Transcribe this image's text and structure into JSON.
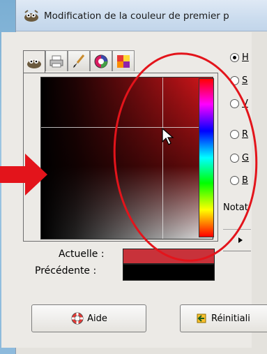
{
  "window": {
    "title": "Modification de la couleur de premier p"
  },
  "tabs": [
    {
      "name": "gimp-selector",
      "icon": "gimp-wilber-icon"
    },
    {
      "name": "printer-selector",
      "icon": "printer-icon"
    },
    {
      "name": "brush-selector",
      "icon": "paintbrush-icon"
    },
    {
      "name": "wheel-selector",
      "icon": "color-wheel-icon"
    },
    {
      "name": "palette-selector",
      "icon": "palette-icon"
    }
  ],
  "channels": [
    {
      "label": "H",
      "selected": true
    },
    {
      "label": "S",
      "selected": false
    },
    {
      "label": "V",
      "selected": false
    },
    {
      "label": "R",
      "selected": false
    },
    {
      "label": "G",
      "selected": false
    },
    {
      "label": "B",
      "selected": false
    }
  ],
  "notation_label": "Notat",
  "current_label": "Actuelle :",
  "previous_label": "Précédente :",
  "current_color": "#c8323a",
  "previous_color": "#000000",
  "buttons": {
    "help": "Aide",
    "reset": "Réinitiali"
  },
  "colors": {
    "annotation_red": "#e3141b",
    "hue_base": "#e8141b"
  }
}
